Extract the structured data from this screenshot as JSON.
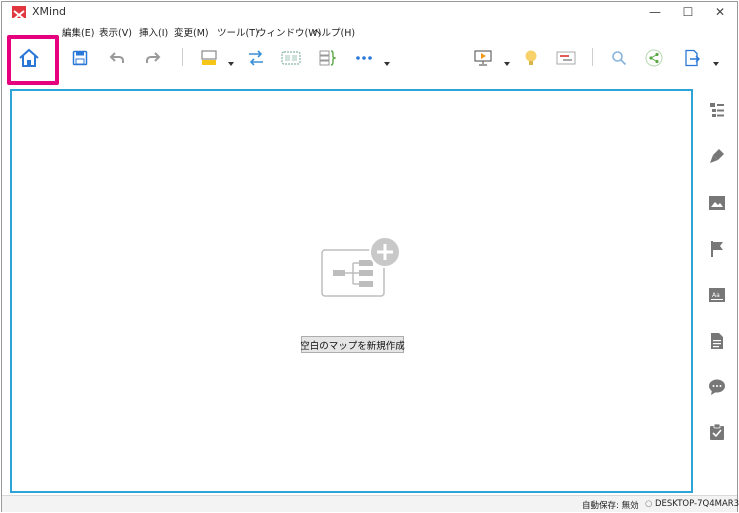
{
  "window": {
    "title": "XMind",
    "controls": {
      "minimize": "—",
      "maximize": "☐",
      "close": "✕"
    }
  },
  "menu": [
    {
      "label": "編集(E)"
    },
    {
      "label": "表示(V)"
    },
    {
      "label": "挿入(I)"
    },
    {
      "label": "変更(M)"
    },
    {
      "label": "ツール(T)"
    },
    {
      "label": "ウィンドウ(W)"
    },
    {
      "label": "ヘルプ(H)"
    }
  ],
  "toolbar": {
    "icons": [
      "home-icon",
      "save-icon",
      "undo-icon",
      "redo-icon",
      "topic-style-icon",
      "relationship-icon",
      "boundary-icon",
      "summary-icon",
      "more-icon",
      "presentation-icon",
      "idea-icon",
      "gantt-icon",
      "search-icon",
      "share-icon",
      "export-icon"
    ],
    "accent": "#2b78d6",
    "highlight_color": "#e6007e"
  },
  "canvas": {
    "border_color": "#2ea3d8",
    "create_button_label": "空白のマップを新規作成"
  },
  "sidebar": {
    "icons": [
      "outline-icon",
      "format-brush-icon",
      "image-icon",
      "marker-flag-icon",
      "text-style-icon",
      "notes-icon",
      "comments-icon",
      "task-icon"
    ]
  },
  "status": {
    "autosave": "自動保存: 無効",
    "device": "DESKTOP-7Q4MAR3"
  }
}
